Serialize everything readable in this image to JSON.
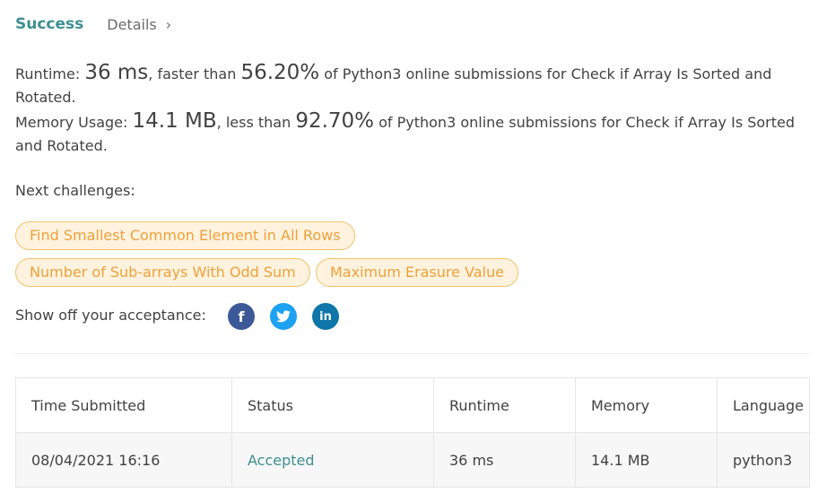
{
  "header": {
    "status": "Success",
    "details_label": "Details"
  },
  "runtime": {
    "prefix": "Runtime: ",
    "value": "36 ms",
    "mid": ", faster than ",
    "percent": "56.20%",
    "suffix": " of Python3 online submissions for Check if Array Is Sorted and Rotated."
  },
  "memory": {
    "prefix": "Memory Usage: ",
    "value": "14.1 MB",
    "mid": ", less than ",
    "percent": "92.70%",
    "suffix": " of Python3 online submissions for Check if Array Is Sorted and Rotated."
  },
  "next": {
    "label": "Next challenges:",
    "items": [
      "Find Smallest Common Element in All Rows",
      "Number of Sub-arrays With Odd Sum",
      "Maximum Erasure Value"
    ]
  },
  "share": {
    "label": "Show off your acceptance:",
    "icons": [
      "facebook-icon",
      "twitter-icon",
      "linkedin-icon"
    ]
  },
  "table": {
    "headers": [
      "Time Submitted",
      "Status",
      "Runtime",
      "Memory",
      "Language"
    ],
    "rows": [
      [
        "08/04/2021 16:16",
        "Accepted",
        "36 ms",
        "14.1 MB",
        "python3"
      ]
    ]
  },
  "colors": {
    "accent": "#3e8f92",
    "pill_text": "#f0a03b",
    "pill_bg": "#fff3df",
    "pill_border": "#f5c16a"
  }
}
